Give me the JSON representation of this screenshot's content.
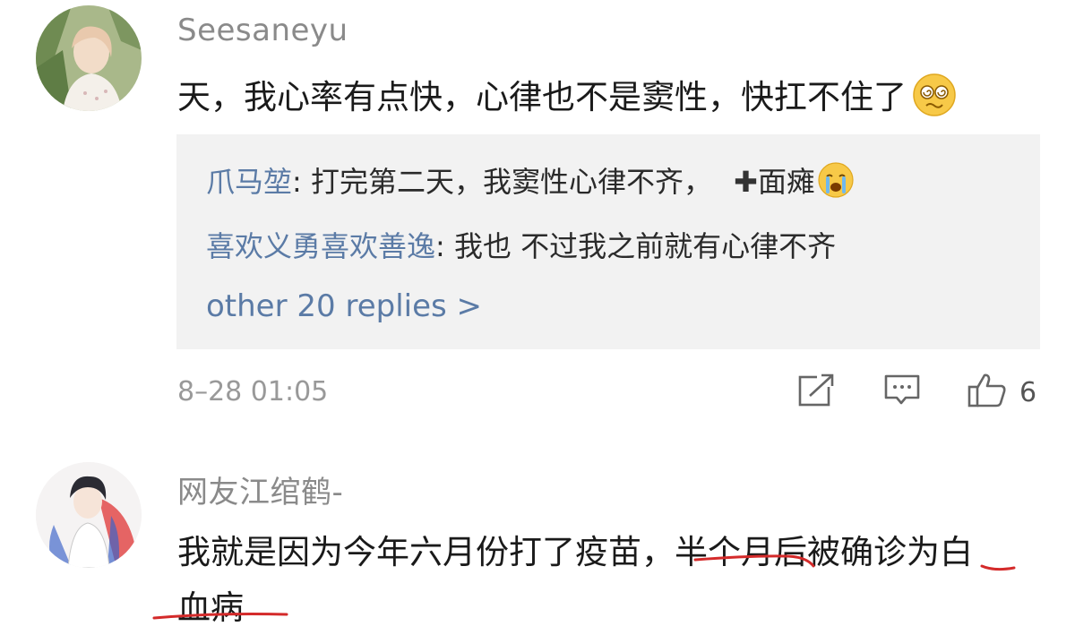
{
  "comment1": {
    "username": "Seesaneyu",
    "text": "天，我心率有点快，心律也不是窦性，快扛不住了",
    "emoji_icon": "woozy-face-icon",
    "replies": [
      {
        "user": "爪马堃",
        "text": ": 打完第二天，我窦性心律不齐，",
        "plus": "✚",
        "text2": "面瘫",
        "emoji_icon": "crying-face-icon"
      },
      {
        "user": "喜欢义勇喜欢善逸",
        "text": ": 我也 不过我之前就有心律不齐"
      }
    ],
    "more_replies": "other 20 replies >",
    "timestamp": "8–28 01:05",
    "like_count": "6"
  },
  "comment2": {
    "username": "网友江绾鹤-",
    "text_line1": "我就是因为今年六月份打了疫苗，半个月后被确诊为白",
    "text_line2": "血病",
    "underline_color": "#d42a2a"
  },
  "colors": {
    "username": "#8a8a8a",
    "link_blue": "#5b7ba6",
    "reply_bg": "#f2f2f2",
    "underline": "#d42a2a"
  }
}
